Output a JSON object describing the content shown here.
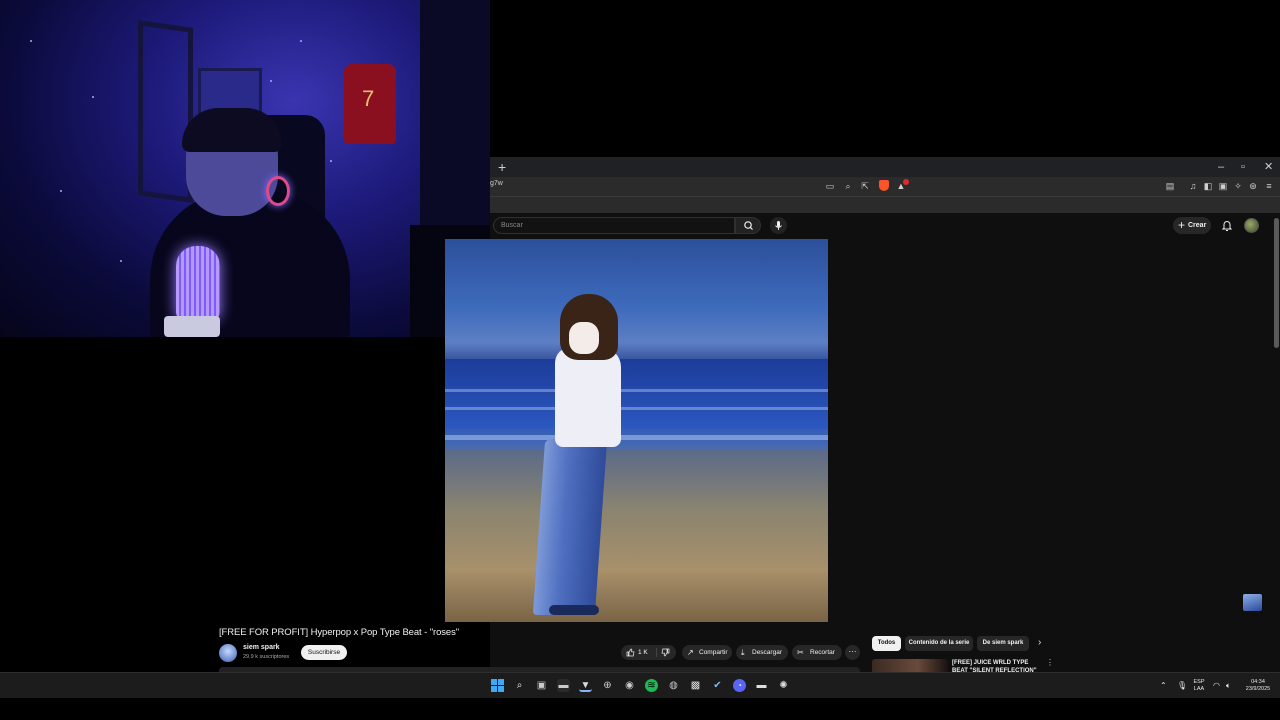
{
  "browser": {
    "url_fragment": "g7w",
    "window_controls": {
      "minimize": "–",
      "maximize": "▫",
      "close": "✕"
    },
    "new_tab": "+"
  },
  "youtube": {
    "search_placeholder": "Buscar",
    "create_label": "Crear",
    "video": {
      "title": "[FREE FOR PROFIT] Hyperpop x Pop Type Beat - \"roses\"",
      "channel_name": "siem spark",
      "subscribers": "29.9 k suscriptores",
      "subscribe_label": "Suscribirse",
      "likes": "1 K",
      "share_label": "Compartir",
      "download_label": "Descargar",
      "clip_label": "Recortar",
      "more_label": "···"
    },
    "chips": [
      "Todos",
      "Contenido de la serie",
      "De siem spark"
    ],
    "recommendation": {
      "title": "[FREE] JUICE WRLD TYPE BEAT \"SILENT REFLECTION\"",
      "more": "⋮"
    }
  },
  "taskbar": {
    "language": "ESP",
    "layout": "LAA",
    "time": "04:34",
    "date": "23/9/2025"
  },
  "colors": {
    "yt_bg": "#0f0f0f",
    "chip_active": "#f1f1f1",
    "brave_orange": "#fb542b",
    "webcam_purple": "#3a35b0"
  },
  "icons": {
    "search": "search-icon",
    "mic": "microphone-icon",
    "bell": "bell-icon",
    "like": "thumbs-up-icon",
    "dislike": "thumbs-down-icon",
    "share": "share-icon",
    "download": "download-icon",
    "clip": "scissors-icon"
  }
}
